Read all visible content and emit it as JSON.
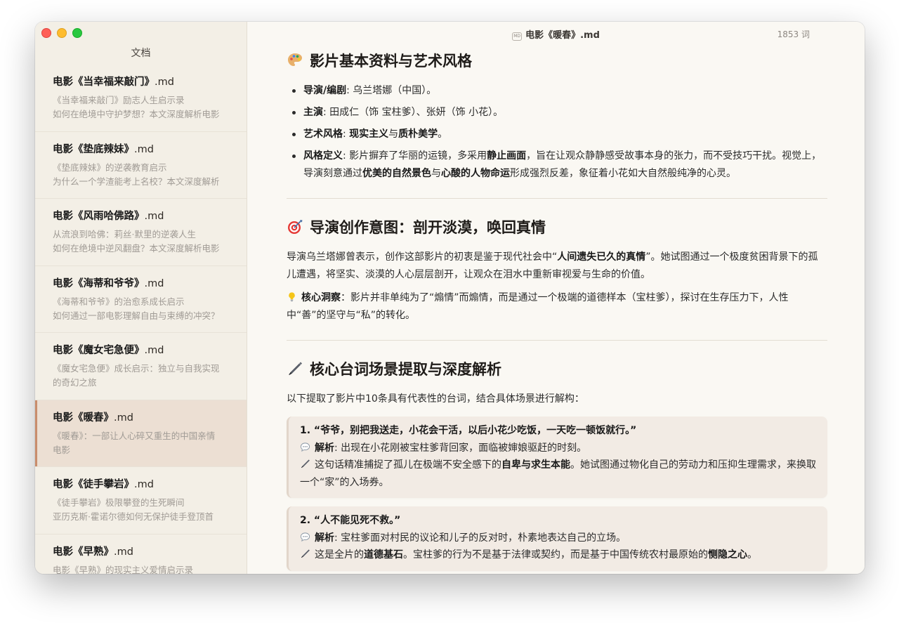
{
  "window": {
    "filename": "电影《暖春》.md",
    "word_count": "1853 词"
  },
  "sidebar": {
    "title": "文档",
    "items": [
      {
        "title_bold": "电影《当幸福来敲门》",
        "title_ext": ".md",
        "line1": "《当幸福来敲门》励志人生启示录",
        "line2": "如何在绝境中守护梦想？本文深度解析电影",
        "active": false
      },
      {
        "title_bold": "电影《垫底辣妹》",
        "title_ext": ".md",
        "line1": "《垫底辣妹》的逆袭教育启示",
        "line2": "为什么一个学渣能考上名校？本文深度解析",
        "active": false
      },
      {
        "title_bold": "电影《风雨哈佛路》",
        "title_ext": ".md",
        "line1": "从流浪到哈佛：莉丝·默里的逆袭人生",
        "line2": "如何在绝境中逆风翻盘？本文深度解析电影",
        "active": false
      },
      {
        "title_bold": "电影《海蒂和爷爷》",
        "title_ext": ".md",
        "line1": "《海蒂和爷爷》的治愈系成长启示",
        "line2": "如何通过一部电影理解自由与束缚的冲突？",
        "active": false
      },
      {
        "title_bold": "电影《魔女宅急便》",
        "title_ext": ".md",
        "line1": "《魔女宅急便》成长启示：独立与自我实现",
        "line2": "的奇幻之旅",
        "active": false
      },
      {
        "title_bold": "电影《暖春》",
        "title_ext": ".md",
        "line1": "《暖春》：一部让人心碎又重生的中国亲情",
        "line2": "电影",
        "active": true
      },
      {
        "title_bold": "电影《徒手攀岩》",
        "title_ext": ".md",
        "line1": "《徒手攀岩》极限攀登的生死瞬间",
        "line2": "亚历克斯·霍诺尔德如何无保护徒手登顶首",
        "active": false
      },
      {
        "title_bold": "电影《早熟》",
        "title_ext": ".md",
        "line1": "电影《早熟》的现实主义爱情启示录",
        "line2": "",
        "active": false
      }
    ]
  },
  "content": {
    "section1": {
      "heading": "影片基本资料与艺术风格",
      "icon": "palette-icon",
      "items": [
        {
          "label": "导演/编剧",
          "text": ": 乌兰塔娜（中国）。"
        },
        {
          "label": "主演",
          "text": ": 田成仁（饰 宝柱爹）、张妍（饰 小花）。"
        },
        {
          "label": "艺术风格",
          "text": ": ",
          "b2": "现实主义",
          "t2": "与",
          "b3": "质朴美学",
          "t3": "。"
        },
        {
          "label": "风格定义",
          "text": ": 影片摒弃了华丽的运镜，多采用",
          "b2": "静止画面",
          "t2": "，旨在让观众静静感受故事本身的张力，而不受技巧干扰。视觉上，导演刻意通过",
          "b3": "优美的自然景色",
          "t3": "与",
          "b4": "心酸的人物命运",
          "t4": "形成强烈反差，象征着小花如大自然般纯净的心灵。"
        }
      ]
    },
    "section2": {
      "heading": "导演创作意图：剖开淡漠，唤回真情",
      "icon": "target-icon",
      "p1_a": "导演乌兰塔娜曾表示，创作这部影片的初衷是鉴于现代社会中“",
      "p1_b": "人间遗失已久的真情",
      "p1_c": "”。她试图通过一个极度贫困背景下的孤儿遭遇，将坚实、淡漠的人心层层剖开，让观众在泪水中重新审视爱与生命的价值。",
      "p2_label": "核心洞察",
      "p2_text": "：影片并非单纯为了“煽情”而煽情，而是通过一个极端的道德样本（宝柱爹），探讨在生存压力下，人性中“善”的坚守与“私”的转化。"
    },
    "section3": {
      "heading": "核心台词场景提取与深度解析",
      "icon": "pen-icon",
      "intro": "以下提取了影片中10条具有代表性的台词，结合具体场景进行解构：",
      "cards": [
        {
          "quote": "1. “爷爷，别把我送走，小花会干活，以后小花少吃饭，一天吃一顿饭就行。”",
          "analysis_label": "解析",
          "analysis_text": ": 出现在小花刚被宝柱爹背回家，面临被婶娘驱赶的时刻。",
          "note_a": "这句话精准捕捉了孤儿在极端不安全感下的",
          "note_b": "自卑与求生本能",
          "note_c": "。她试图通过物化自己的劳动力和压抑生理需求，来换取一个“家”的入场券。"
        },
        {
          "quote": "2. “人不能见死不救。”",
          "analysis_label": "解析",
          "analysis_text": ": 宝柱爹面对村民的议论和儿子的反对时，朴素地表达自己的立场。",
          "note_a": "这是全片的",
          "note_b": "道德基石",
          "note_c": "。宝柱爹的行为不是基于法律或契约，而是基于中国传统农村最原始的",
          "note_d": "恻隐之心",
          "note_e": "。"
        }
      ]
    }
  }
}
